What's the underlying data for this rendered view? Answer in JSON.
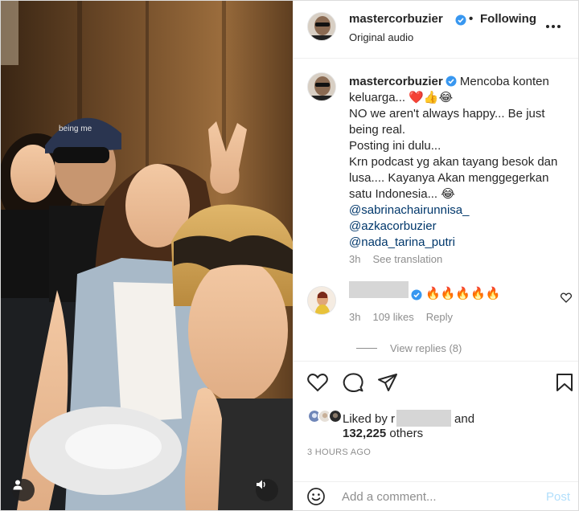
{
  "post": {
    "username": "mastercorbuzier",
    "follow_state": "Following",
    "separator": "•",
    "audio_label": "Original audio",
    "verified_color": "#3897f0"
  },
  "caption": {
    "username": "mastercorbuzier",
    "line1": "Mencoba konten keluarga...",
    "emojis1": "❤️👍😂",
    "line2": "NO we aren't always happy... Be just being real.",
    "line3": "Posting ini dulu...",
    "line4": "Krn podcast yg akan tayang besok dan lusa.... Kayanya Akan menggegerkan satu Indonesia...",
    "emoji4": "😂",
    "mentions": [
      "@sabrinachairunnisa_",
      "@azkacorbuzier",
      "@nada_tarina_putri"
    ],
    "time": "3h",
    "see_translation": "See translation"
  },
  "comment": {
    "text": "🔥🔥🔥🔥🔥",
    "time": "3h",
    "likes": "109 likes",
    "reply": "Reply",
    "view_replies": "View replies (8)"
  },
  "engagement": {
    "liked_by_prefix": "Liked by",
    "liked_by_fragment": "r",
    "and": "and",
    "count": "132,225",
    "others": "others",
    "timestamp": "3 HOURS AGO"
  },
  "composer": {
    "placeholder": "Add a comment...",
    "post_label": "Post"
  }
}
